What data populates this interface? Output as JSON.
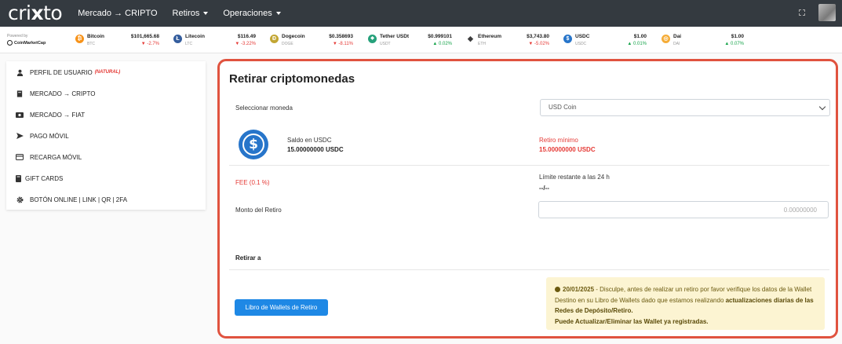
{
  "navbar": {
    "logo_prefix": "cri",
    "logo_x": "x",
    "logo_suffix": "to",
    "items": [
      {
        "label": "Mercado → CRIPTO",
        "dropdown": false
      },
      {
        "label": "Retiros",
        "dropdown": true
      },
      {
        "label": "Operaciones",
        "dropdown": true
      }
    ]
  },
  "ticker": {
    "powered_by": "Powered by",
    "provider": "CoinMarketCap",
    "coins": [
      {
        "name": "Bitcoin",
        "symbol": "BTC",
        "price": "$101,665.68",
        "change": "▼ -2.7%",
        "direction": "down",
        "color": "#f7931a",
        "glyph": "₿"
      },
      {
        "name": "Litecoin",
        "symbol": "LTC",
        "price": "$116.49",
        "change": "▼ -3.22%",
        "direction": "down",
        "color": "#345d9d",
        "glyph": "Ł"
      },
      {
        "name": "Dogecoin",
        "symbol": "DOGE",
        "price": "$0.358693",
        "change": "▼ -8.11%",
        "direction": "down",
        "color": "#c2a633",
        "glyph": "Ð"
      },
      {
        "name": "Tether USDt",
        "symbol": "USDT",
        "price": "$0.999101",
        "change": "▲ 0.02%",
        "direction": "up",
        "color": "#26a17b",
        "glyph": "◆"
      },
      {
        "name": "Ethereum",
        "symbol": "ETH",
        "price": "$3,743.80",
        "change": "▼ -5.02%",
        "direction": "down",
        "color": "#3c3c3d",
        "glyph": "◆"
      },
      {
        "name": "USDC",
        "symbol": "USDC",
        "price": "$1.00",
        "change": "▲ 0.01%",
        "direction": "up",
        "color": "#2775ca",
        "glyph": "$"
      },
      {
        "name": "Dai",
        "symbol": "DAI",
        "price": "$1.00",
        "change": "▲ 0.07%",
        "direction": "up",
        "color": "#f5ac37",
        "glyph": "◎"
      }
    ]
  },
  "sidebar": {
    "items": [
      {
        "label": "PERFIL DE USUARIO",
        "tag": "(NATURAL)",
        "icon": "user-icon"
      },
      {
        "label": "MERCADO → CRIPTO",
        "tag": "",
        "icon": "book-icon"
      },
      {
        "label": "MERCADO → FIAT",
        "tag": "",
        "icon": "money-icon"
      },
      {
        "label": "PAGO MÓVIL",
        "tag": "",
        "icon": "send-icon"
      },
      {
        "label": "RECARGA MÓVIL",
        "tag": "",
        "icon": "card-icon"
      },
      {
        "label": "GIFT CARDS",
        "tag": "",
        "icon": "gift-icon"
      },
      {
        "label": "BOTÓN ONLINE | LINK | QR | 2FA",
        "tag": "",
        "icon": "gear-icon"
      }
    ]
  },
  "withdraw": {
    "title": "Retirar criptomonedas",
    "select_label": "Seleccionar moneda",
    "select_value": "USD Coin",
    "balance_label": "Saldo en USDC",
    "balance_value": "15.00000000 USDC",
    "min_label": "Retiro mínimo",
    "min_value": "15.00000000 USDC",
    "fee_label": "FEE (0.1 %)",
    "limit_label": "Límite restante a las 24 h",
    "limit_value": "--/--",
    "amount_label": "Monto del Retiro",
    "amount_placeholder": "0.00000000",
    "withdraw_to_label": "Retirar a",
    "wallet_button": "Libro de Wallets de Retiro",
    "alert": {
      "date": "20/01/2025",
      "text1": " - Disculpe, antes de realizar un retiro por favor verifique los datos de la Wallet Destino en su Libro de Wallets dado que estamos realizando ",
      "bold1": "actualizaciones diarias de las Redes de Depósito/Retiro.",
      "bold2": "Puede Actualizar/Eliminar las Wallet ya registradas."
    }
  },
  "colors": {
    "navbar": "#343a40",
    "accent_border": "#e0533f",
    "button": "#1e88e5",
    "danger": "#e53935",
    "alert_bg": "#fcf4d2"
  }
}
